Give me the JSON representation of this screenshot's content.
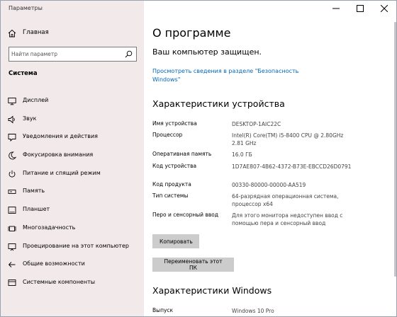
{
  "app": {
    "title": "Параметры"
  },
  "sidebar": {
    "home_label": "Главная",
    "search_placeholder": "Найти параметр",
    "section_title": "Система",
    "items": [
      {
        "label": "Дисплей",
        "icon": "monitor-icon"
      },
      {
        "label": "Звук",
        "icon": "speaker-icon"
      },
      {
        "label": "Уведомления и действия",
        "icon": "notifications-icon"
      },
      {
        "label": "Фокусировка внимания",
        "icon": "moon-icon"
      },
      {
        "label": "Питание и спящий режим",
        "icon": "power-icon"
      },
      {
        "label": "Память",
        "icon": "storage-icon"
      },
      {
        "label": "Планшет",
        "icon": "tablet-icon"
      },
      {
        "label": "Многозадачность",
        "icon": "multitasking-icon"
      },
      {
        "label": "Проецирование на этот компьютер",
        "icon": "projection-icon"
      },
      {
        "label": "Общие возможности",
        "icon": "shared-experiences-icon"
      },
      {
        "label": "Системные компоненты",
        "icon": "components-icon"
      }
    ]
  },
  "main": {
    "title": "О программе",
    "protected_text": "Ваш компьютер защищен.",
    "security_link": "Просмотреть сведения в разделе \"Безопасность Windows\"",
    "device_specs_title": "Характеристики устройства",
    "device_specs": [
      {
        "label": "Имя устройства",
        "value": "DESKTOP-1AIC22C"
      },
      {
        "label": "Процессор",
        "value": "Intel(R) Core(TM) i5-8400 CPU @ 2.80GHz 2.81 GHz"
      },
      {
        "label": "Оперативная память",
        "value": "16.0 ГБ"
      },
      {
        "label": "Код устройства",
        "value": "1D7AE807-4B62-4372-B73E-EBCCD26D0791"
      },
      {
        "label": "Код продукта",
        "value": "00330-80000-00000-AA519"
      },
      {
        "label": "Тип системы",
        "value": "64-разрядная операционная система, процессор x64"
      },
      {
        "label": "Перо и сенсорный ввод",
        "value": "Для этого монитора недоступен ввод с помощью пера и сенсорный ввод"
      }
    ],
    "copy_button": "Копировать",
    "rename_button": "Переименовать этот ПК",
    "windows_specs_title": "Характеристики Windows",
    "windows_specs": [
      {
        "label": "Выпуск",
        "value": "Windows 10 Pro"
      }
    ]
  },
  "colors": {
    "sidebar_bg": "#f2e9eb",
    "link": "#0067b8",
    "button_bg": "#cccccc"
  }
}
